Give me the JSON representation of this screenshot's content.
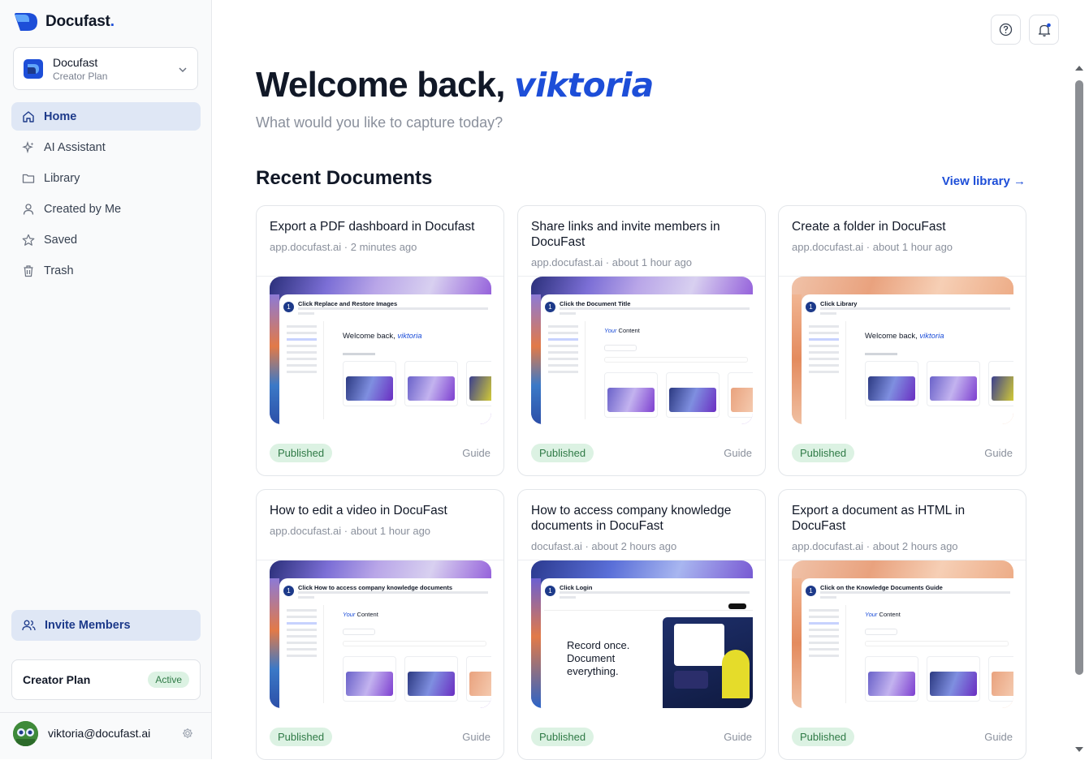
{
  "brand": {
    "name": "Docufast",
    "dot": "."
  },
  "workspace": {
    "name": "Docufast",
    "plan": "Creator Plan"
  },
  "nav": [
    {
      "label": "Home",
      "icon": "home-icon",
      "active": true
    },
    {
      "label": "AI Assistant",
      "icon": "sparkle-icon"
    },
    {
      "label": "Library",
      "icon": "folder-icon"
    },
    {
      "label": "Created by Me",
      "icon": "user-icon"
    },
    {
      "label": "Saved",
      "icon": "star-icon"
    },
    {
      "label": "Trash",
      "icon": "trash-icon"
    }
  ],
  "invite_label": "Invite Members",
  "plan": {
    "label": "Creator Plan",
    "status": "Active"
  },
  "user": {
    "email": "viktoria@docufast.ai"
  },
  "header": {
    "greeting": "Welcome back, ",
    "name": "viktoria",
    "subtitle": "What would you like to capture today?"
  },
  "recent": {
    "title": "Recent Documents",
    "view_library": "View library →"
  },
  "documents": [
    {
      "title": "Export a PDF dashboard in Docufast",
      "meta": "app.docufast.ai · 2 minutes ago",
      "status": "Published",
      "type": "Guide",
      "step_title": "Click Replace and Restore Images",
      "gradient": "purple"
    },
    {
      "title": "Share links and invite members in DocuFast",
      "meta": "app.docufast.ai · about 1 hour ago",
      "status": "Published",
      "type": "Guide",
      "step_title": "Click the Document Title",
      "gradient": "purple"
    },
    {
      "title": "Create a folder in DocuFast",
      "meta": "app.docufast.ai · about 1 hour ago",
      "status": "Published",
      "type": "Guide",
      "step_title": "Click Library",
      "gradient": "peach"
    },
    {
      "title": "How to edit a video in DocuFast",
      "meta": "app.docufast.ai · about 1 hour ago",
      "status": "Published",
      "type": "Guide",
      "step_title": "Click How to access company knowledge documents",
      "gradient": "purple"
    },
    {
      "title": "How to access company knowledge documents in DocuFast",
      "meta": "docufast.ai · about 2 hours ago",
      "status": "Published",
      "type": "Guide",
      "step_title": "Click Login",
      "gradient": "blue"
    },
    {
      "title": "Export a document as HTML in DocuFast",
      "meta": "app.docufast.ai · about 2 hours ago",
      "status": "Published",
      "type": "Guide",
      "step_title": "Click on the Knowledge Documents Guide",
      "gradient": "peach"
    }
  ],
  "thumb_text": {
    "welcome": "Welcome back, ",
    "name": "viktoria",
    "your_content": "Content",
    "your": "Your",
    "record": "Record once. Document everything."
  },
  "colors": {
    "accent": "#1d4ed8",
    "active_bg": "#dfe7f5",
    "published_bg": "#dcf2e3",
    "published_fg": "#2f7a46"
  }
}
